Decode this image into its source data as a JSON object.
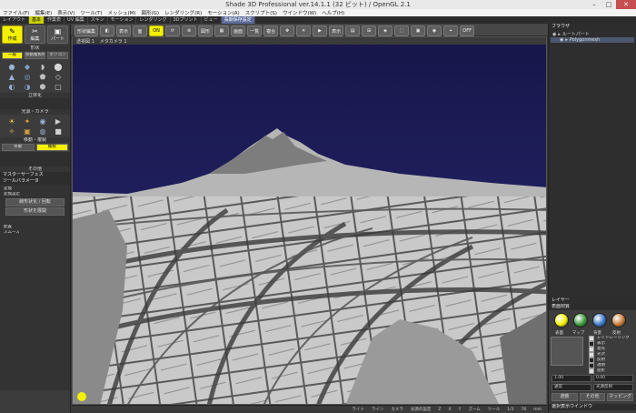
{
  "window": {
    "title": "Shade 3D Professional ver.14.1.1 (32 ビット) / OpenGL 2.1"
  },
  "menu": [
    "ファイル(F)",
    "編集(E)",
    "表示(V)",
    "ツール(T)",
    "メッシュ(M)",
    "図形(G)",
    "レンダリング(R)",
    "モーション(A)",
    "スクリプト(S)",
    "ウインドウ(W)",
    "ヘルプ(H)"
  ],
  "tabs": [
    {
      "label": "レイアウト",
      "state": ""
    },
    {
      "label": "基本",
      "state": "on"
    },
    {
      "label": "作業表",
      "state": ""
    },
    {
      "label": "UV 編集",
      "state": ""
    },
    {
      "label": "スキン",
      "state": ""
    },
    {
      "label": "モーション",
      "state": ""
    },
    {
      "label": "レンダリング",
      "state": ""
    },
    {
      "label": "3Dプリント",
      "state": ""
    },
    {
      "label": "ビュー",
      "state": ""
    },
    {
      "label": "長期保存設定",
      "state": "sel"
    }
  ],
  "toolbar": {
    "b1": "形状編集",
    "b2": "表示",
    "b3": "面",
    "b4": "面",
    "b5": "図形",
    "b6": "画面",
    "b7": "一覧",
    "b8": "複合",
    "b9": "表示",
    "on_label": "ON",
    "off_label": "OFF"
  },
  "left": {
    "modes": [
      {
        "label": "作成",
        "icon": "✎",
        "state": "hi"
      },
      {
        "label": "編集",
        "icon": "✂",
        "state": ""
      },
      {
        "label": "パート",
        "icon": "▣",
        "state": ""
      }
    ],
    "sections": {
      "shape": "形状",
      "solid": "立体化",
      "light": "光源・カメラ",
      "move": "移動・複製",
      "misc": "その他",
      "tool": "ツールパラメータ",
      "hint": "マスターサーフェス"
    },
    "seg1": [
      "一般",
      "移動複製制御",
      "ポリゴン"
    ],
    "seg2": [
      "移動",
      "複製"
    ],
    "shape_icons": [
      "●",
      "◆",
      "◗",
      "⬤",
      "▲",
      "◎",
      "⬟",
      "◇",
      "◐",
      "◑",
      "⬢",
      "▢"
    ],
    "light_icons": [
      "☀",
      "✦",
      "◉",
      "▶",
      "✧",
      "▣",
      "◍",
      "■"
    ],
    "tool_lines": [
      "変換",
      "変換設定"
    ],
    "tool_buttons": [
      "線形状化 / 回転",
      "形状を展開"
    ],
    "tool_lines2": [
      "配置",
      "スムーズ"
    ]
  },
  "viewport": {
    "title": "透視図 1",
    "camera": "メタカメラ 1",
    "status": [
      "ライト",
      "ライン",
      "カメラ",
      "光源の設定",
      "Z",
      "X",
      "Y",
      "ズーム",
      "ツール",
      "1/3",
      "76",
      "mm"
    ]
  },
  "right": {
    "tree_header": "ブラウザ",
    "tree": [
      {
        "label": "ルートパート",
        "indent": 0,
        "sel": false
      },
      {
        "label": "Polygonmesh",
        "indent": 1,
        "sel": true
      }
    ],
    "tree_footer": "レイヤー",
    "surface_header": "表面材質",
    "swatches": [
      {
        "label": "表面",
        "color": "#f4f100"
      },
      {
        "label": "マップ",
        "color": "#3b9b3b"
      },
      {
        "label": "背景",
        "color": "#3c78c8"
      },
      {
        "label": "反射",
        "color": "#c67a35"
      }
    ],
    "props": [
      {
        "label": "レイトレーシング",
        "checked": true
      },
      {
        "label": "表示",
        "checked": false
      },
      {
        "label": "発光",
        "checked": true
      },
      {
        "label": "光沢",
        "checked": true
      },
      {
        "label": "反射",
        "checked": false
      },
      {
        "label": "透明",
        "checked": false
      },
      {
        "label": "屈折",
        "checked": true
      }
    ],
    "values": [
      "1.00",
      "0.00"
    ],
    "dropdowns": [
      "通常",
      "光源反射"
    ],
    "bottom": [
      "遮蔽",
      "その他",
      "マッピング"
    ],
    "footer": "選択表示ウインドウ"
  }
}
